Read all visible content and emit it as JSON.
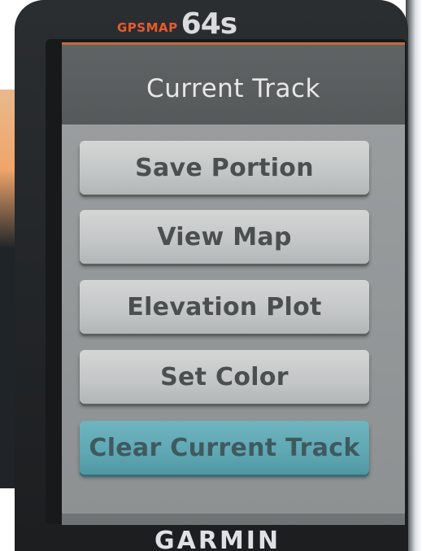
{
  "device": {
    "model_line": "GPSMAP",
    "model_number": "64s",
    "brand": "GARMIN"
  },
  "screen": {
    "title": "Current Track",
    "menu_items": [
      {
        "label": "Save Portion",
        "selected": false
      },
      {
        "label": "View Map",
        "selected": false
      },
      {
        "label": "Elevation Plot",
        "selected": false
      },
      {
        "label": "Set Color",
        "selected": false
      },
      {
        "label": "Clear Current Track",
        "selected": true
      }
    ]
  },
  "colors": {
    "brand_accent": "#ea5a2a",
    "selected_item": "#5ea7b3",
    "button_face": "#c8cbcb",
    "title_bar": "#5a5e5f"
  }
}
